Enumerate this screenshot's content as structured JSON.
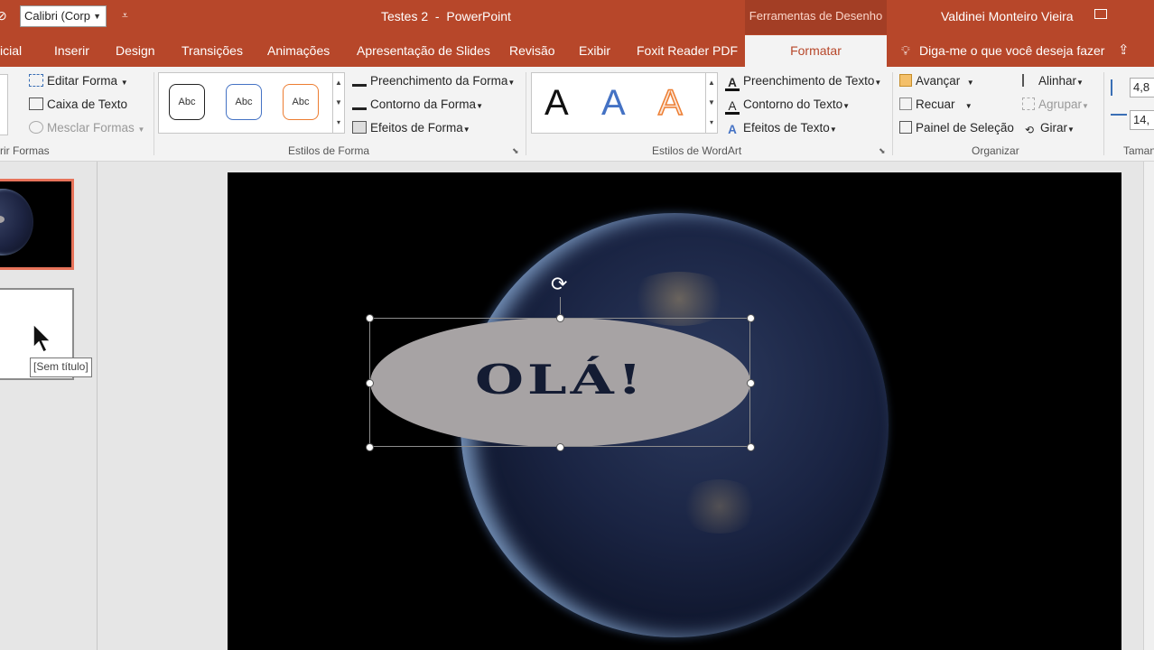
{
  "title_bar": {
    "font_name": "Calibri (Corp",
    "document_title": "Testes 2  -  PowerPoint",
    "contextual_group": "Ferramentas de Desenho",
    "user_name": "Valdinei Monteiro Vieira"
  },
  "tabs": {
    "items": [
      "Página Inicial",
      "Inserir",
      "Design",
      "Transições",
      "Animações",
      "Apresentação de Slides",
      "Revisão",
      "Exibir",
      "Foxit Reader PDF"
    ],
    "visible_first": "icial",
    "active": "Formatar",
    "tell_me": "Diga-me o que você deseja fazer"
  },
  "ribbon": {
    "insert_shapes": {
      "edit_shape": "Editar Forma",
      "text_box": "Caixa de Texto",
      "merge_shapes": "Mesclar Formas",
      "group_label": "rir Formas"
    },
    "shape_styles": {
      "presets": [
        "Abc",
        "Abc",
        "Abc"
      ],
      "fill": "Preenchimento da Forma",
      "outline": "Contorno da Forma",
      "effects": "Efeitos de Forma",
      "group_label": "Estilos de Forma"
    },
    "wordart": {
      "presets": [
        "A",
        "A",
        "A"
      ],
      "text_fill": "Preenchimento de Texto",
      "text_outline": "Contorno do Texto",
      "text_effects": "Efeitos de Texto",
      "group_label": "Estilos de WordArt"
    },
    "arrange": {
      "bring_forward": "Avançar",
      "send_backward": "Recuar",
      "selection_pane": "Painel de Seleção",
      "align": "Alinhar",
      "group": "Agrupar",
      "rotate": "Girar",
      "group_label": "Organizar"
    },
    "size": {
      "height": "4,8",
      "width": "14,",
      "group_label": "Taman"
    }
  },
  "slide_panel": {
    "tooltip": "[Sem título]"
  },
  "slide": {
    "wordart_text": "OLÁ!"
  },
  "colors": {
    "accent": "#b7472a",
    "contextual": "#a33e25",
    "ribbon_bg": "#f3f3f3",
    "shape_fill": "#a7a3a4",
    "wordart_fill": "#141c33"
  }
}
